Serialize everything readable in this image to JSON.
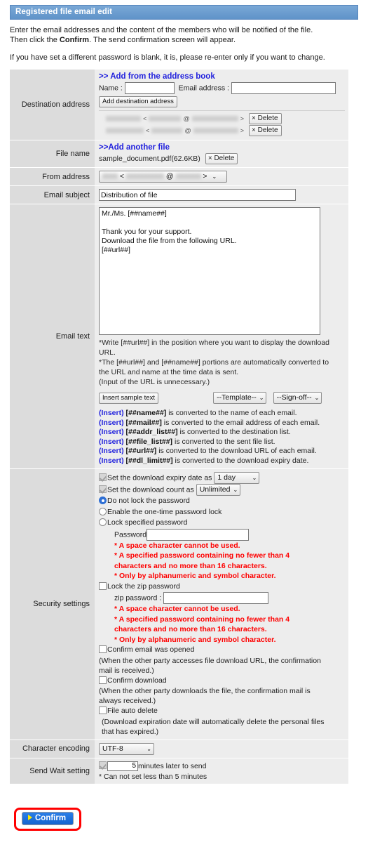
{
  "header": {
    "title": "Registered file email edit"
  },
  "intro": {
    "line1_a": "Enter the email addresses and the content of the members who will be notified of the file.",
    "line1_b": "Then click the ",
    "line1_bold": "Confirm",
    "line1_c": ". The send confirmation screen will appear.",
    "line2": "If you have set a different password is blank, it is, please re-enter only if you want to change."
  },
  "destination": {
    "label": "Destination address",
    "address_book_link": ">> Add from the address book",
    "name_label": "Name :",
    "name_value": "",
    "email_label": "Email address :",
    "email_value": "",
    "add_button": "Add destination address",
    "rows": [
      {
        "name": "",
        "open": "<",
        "at": "@",
        "close": ">",
        "delete_label": "Delete",
        "delete_icon": "×"
      },
      {
        "name": "",
        "open": "<",
        "at": "@",
        "close": ">",
        "delete_label": "Delete",
        "delete_icon": "×"
      }
    ]
  },
  "file_name": {
    "label": "File name",
    "add_link": ">>Add another file",
    "file": "sample_document.pdf(62.6KB)",
    "delete_label": "Delete",
    "delete_icon": "×"
  },
  "from_address": {
    "label": "From address",
    "open": "<",
    "at": "@",
    "close": ">",
    "caret": "⌄"
  },
  "email_subject": {
    "label": "Email subject",
    "value": "Distribution of file",
    "placeholder": ""
  },
  "email_text": {
    "label": "Email text",
    "body": "Mr./Ms. [##name##]\n\nThank you for your support.\nDownload the file from the following URL.\n[##url##]",
    "notes": [
      "*Write [##url##] in the position where you want to display the download URL.",
      "*The [##url##] and [##name##] portions are automatically converted to the URL and name at the time data is sent.",
      "(Input of the URL is unnecessary.)"
    ],
    "insert_sample_button": "Insert sample text",
    "template_select": "--Template--",
    "signoff_select": "--Sign-off--",
    "caret": "⌄",
    "inserts": [
      {
        "tag": "(Insert)",
        "key": "[##name##]",
        "desc": " is converted to the name of each email."
      },
      {
        "tag": "(Insert)",
        "key": "[##mail##]",
        "desc": " is converted to the email address of each email."
      },
      {
        "tag": "(Insert)",
        "key": "[##addr_list##]",
        "desc": " is converted to the destination list."
      },
      {
        "tag": "(Insert)",
        "key": "[##file_list##]",
        "desc": " is converted to the sent file list."
      },
      {
        "tag": "(Insert)",
        "key": "[##url##]",
        "desc": " is converted to the download URL of each email."
      },
      {
        "tag": "(Insert)",
        "key": "[##dl_limit##]",
        "desc": " is converted to the download expiry date."
      }
    ]
  },
  "security": {
    "label": "Security settings",
    "expiry_label": "Set the download expiry date as",
    "expiry_value": "1 day",
    "count_label": "Set the download count as",
    "count_value": "Unlimited",
    "caret": "⌄",
    "radio_no_lock": "Do not lock the password",
    "radio_one_time": "Enable the one-time password lock",
    "radio_specified": "Lock specified password",
    "password_label": "Password",
    "password_value": "",
    "pw_rules": [
      "* A space character cannot be used.",
      "* A specified password containing no fewer than 4 characters and no more than 16 characters.",
      "* Only by alphanumeric and symbol character."
    ],
    "zip_lock_label": "Lock the zip password",
    "zip_password_label": "zip password :",
    "zip_password_value": "",
    "zip_rules": [
      "* A space character cannot be used.",
      "* A specified password containing no fewer than 4 characters and no more than 16 characters.",
      "* Only by alphanumeric and symbol character."
    ],
    "confirm_open_label": "Confirm email was opened",
    "confirm_open_note": "(When the other party accesses file download URL, the confirmation mail is received.)",
    "confirm_dl_label": "Confirm download",
    "confirm_dl_note": "(When the other party downloads the file, the confirmation mail is always received.)",
    "auto_delete_label": "File auto delete",
    "auto_delete_note": "(Download expiration date will automatically delete the personal files that has expired.)"
  },
  "encoding": {
    "label": "Character encoding",
    "value": "UTF-8",
    "caret": "⌄"
  },
  "send_wait": {
    "label": "Send Wait setting",
    "minutes_value": "5",
    "suffix": "minutes later to send",
    "note": "* Can not set less than 5 minutes"
  },
  "footer": {
    "confirm_label": "Confirm"
  },
  "colors": {
    "header_blue": "#5f93c9",
    "link_blue": "#2222dd",
    "warning_red": "#fe0000",
    "button_blue": "#1463cf",
    "highlight_red": "#ff0000",
    "label_gray": "#dcdcdc",
    "value_gray": "#ededed"
  }
}
